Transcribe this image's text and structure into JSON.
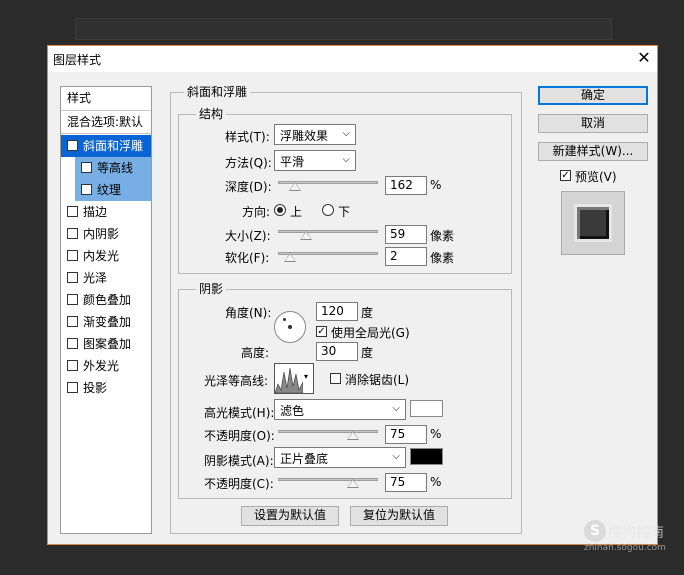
{
  "dialog": {
    "title": "图层样式",
    "close_icon": "close-icon"
  },
  "left": {
    "header": "样式",
    "blending": "混合选项:默认",
    "items": [
      {
        "label": "斜面和浮雕",
        "checked": true,
        "selected": true
      },
      {
        "label": "等高线",
        "checked": false,
        "sub": true
      },
      {
        "label": "纹理",
        "checked": false,
        "sub": true
      },
      {
        "label": "描边",
        "checked": false
      },
      {
        "label": "内阴影",
        "checked": false
      },
      {
        "label": "内发光",
        "checked": false
      },
      {
        "label": "光泽",
        "checked": false
      },
      {
        "label": "颜色叠加",
        "checked": false
      },
      {
        "label": "渐变叠加",
        "checked": false
      },
      {
        "label": "图案叠加",
        "checked": false
      },
      {
        "label": "外发光",
        "checked": false
      },
      {
        "label": "投影",
        "checked": false
      }
    ]
  },
  "bevel": {
    "title": "斜面和浮雕",
    "structure": {
      "title": "结构",
      "style_label": "样式(T):",
      "style_value": "浮雕效果",
      "technique_label": "方法(Q):",
      "technique_value": "平滑",
      "depth_label": "深度(D):",
      "depth_value": "162",
      "depth_unit": "%",
      "depth_fraction": 0.17,
      "direction_label": "方向:",
      "direction_up": "上",
      "direction_down": "下",
      "direction_selected": "上",
      "size_label": "大小(Z):",
      "size_value": "59",
      "size_unit": "像素",
      "size_fraction": 0.28,
      "soften_label": "软化(F):",
      "soften_value": "2",
      "soften_unit": "像素",
      "soften_fraction": 0.12
    },
    "shading": {
      "title": "阴影",
      "angle_label": "角度(N):",
      "angle_value": "120",
      "angle_unit": "度",
      "global_light_label": "使用全局光(G)",
      "global_light_checked": true,
      "altitude_label": "高度:",
      "altitude_value": "30",
      "altitude_unit": "度",
      "gloss_contour_label": "光泽等高线:",
      "antialias_label": "消除锯齿(L)",
      "antialias_checked": false,
      "highlight_mode_label": "高光模式(H):",
      "highlight_mode_value": "滤色",
      "highlight_color": "#ffffff",
      "highlight_opacity_label": "不透明度(O):",
      "highlight_opacity_value": "75",
      "highlight_opacity_unit": "%",
      "highlight_opacity_fraction": 0.75,
      "shadow_mode_label": "阴影模式(A):",
      "shadow_mode_value": "正片叠底",
      "shadow_color": "#000000",
      "shadow_opacity_label": "不透明度(C):",
      "shadow_opacity_value": "75",
      "shadow_opacity_unit": "%",
      "shadow_opacity_fraction": 0.75
    },
    "make_default": "设置为默认值",
    "reset_default": "复位为默认值"
  },
  "right": {
    "ok": "确定",
    "cancel": "取消",
    "new_style": "新建样式(W)...",
    "preview_label": "预览(V)",
    "preview_checked": true
  },
  "watermark": {
    "text1": "搜狗指南",
    "text2": "zhinan.sogou.com"
  }
}
